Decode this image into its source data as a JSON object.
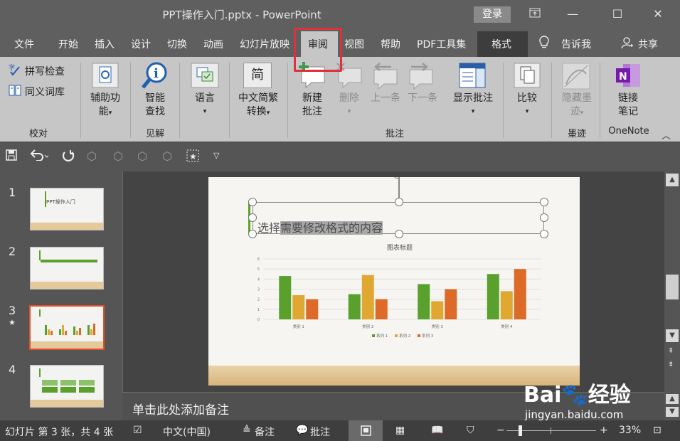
{
  "window": {
    "title": "PPT操作入门.pptx  -  PowerPoint",
    "login_label": "登录"
  },
  "tabs": [
    {
      "label": "文件"
    },
    {
      "label": "开始"
    },
    {
      "label": "插入"
    },
    {
      "label": "设计"
    },
    {
      "label": "切换"
    },
    {
      "label": "动画"
    },
    {
      "label": "幻灯片放映"
    },
    {
      "label": "审阅"
    },
    {
      "label": "视图"
    },
    {
      "label": "帮助"
    },
    {
      "label": "PDF工具集"
    },
    {
      "label": "格式"
    }
  ],
  "tell_me": "告诉我",
  "share": "共享",
  "ribbon": {
    "spell_check": "拼写检查",
    "thesaurus": "同义词库",
    "group_proofing": "校对",
    "accessibility_line1": "辅助功",
    "accessibility_line2": "能",
    "smart_lookup_line1": "智能",
    "smart_lookup_line2": "查找",
    "group_insights": "见解",
    "language": "语言",
    "convert_line1": "中文简繁",
    "convert_line2": "转换",
    "convert_icon_char": "简",
    "new_comment_line1": "新建",
    "new_comment_line2": "批注",
    "delete": "删除",
    "previous": "上一条",
    "next": "下一条",
    "show_comments": "显示批注",
    "group_comments": "批注",
    "compare": "比较",
    "hide_ink_line1": "隐藏墨",
    "hide_ink_line2": "迹",
    "group_ink": "墨迹",
    "onenote_line1": "链接",
    "onenote_line2": "笔记",
    "group_onenote": "OneNote"
  },
  "thumbnails": [
    {
      "num": "1",
      "title": "PPT操作入门"
    },
    {
      "num": "2"
    },
    {
      "num": "3",
      "star": "★"
    },
    {
      "num": "4"
    }
  ],
  "slide": {
    "text_normal": "选择",
    "text_selected": "需要修改格式的内容",
    "chart_data": {
      "type": "bar",
      "title": "图表标题",
      "categories": [
        "类别 1",
        "类别 2",
        "类别 3",
        "类别 4"
      ],
      "series": [
        {
          "name": "系列 1",
          "color": "#5aa02c",
          "values": [
            4.3,
            2.5,
            3.5,
            4.5
          ]
        },
        {
          "name": "系列 2",
          "color": "#e0a830",
          "values": [
            2.4,
            4.4,
            1.8,
            2.8
          ]
        },
        {
          "name": "系列 3",
          "color": "#dd6a26",
          "values": [
            2.0,
            2.0,
            3.0,
            5.0
          ]
        }
      ],
      "yticks": [
        "0",
        "1",
        "2",
        "3",
        "4",
        "5",
        "6"
      ],
      "ylim": [
        0,
        6
      ],
      "legend": "bottom"
    }
  },
  "notes_placeholder": "单击此处添加备注",
  "status": {
    "slide_info": "幻灯片 第 3 张，共 4 张",
    "language": "中文(中国)",
    "notes": "备注",
    "comments": "批注",
    "zoom": "33%",
    "minus": "−",
    "plus": "+"
  },
  "watermark": {
    "brand": "Bai",
    "brand2": "经验",
    "url": "jingyan.baidu.com"
  }
}
